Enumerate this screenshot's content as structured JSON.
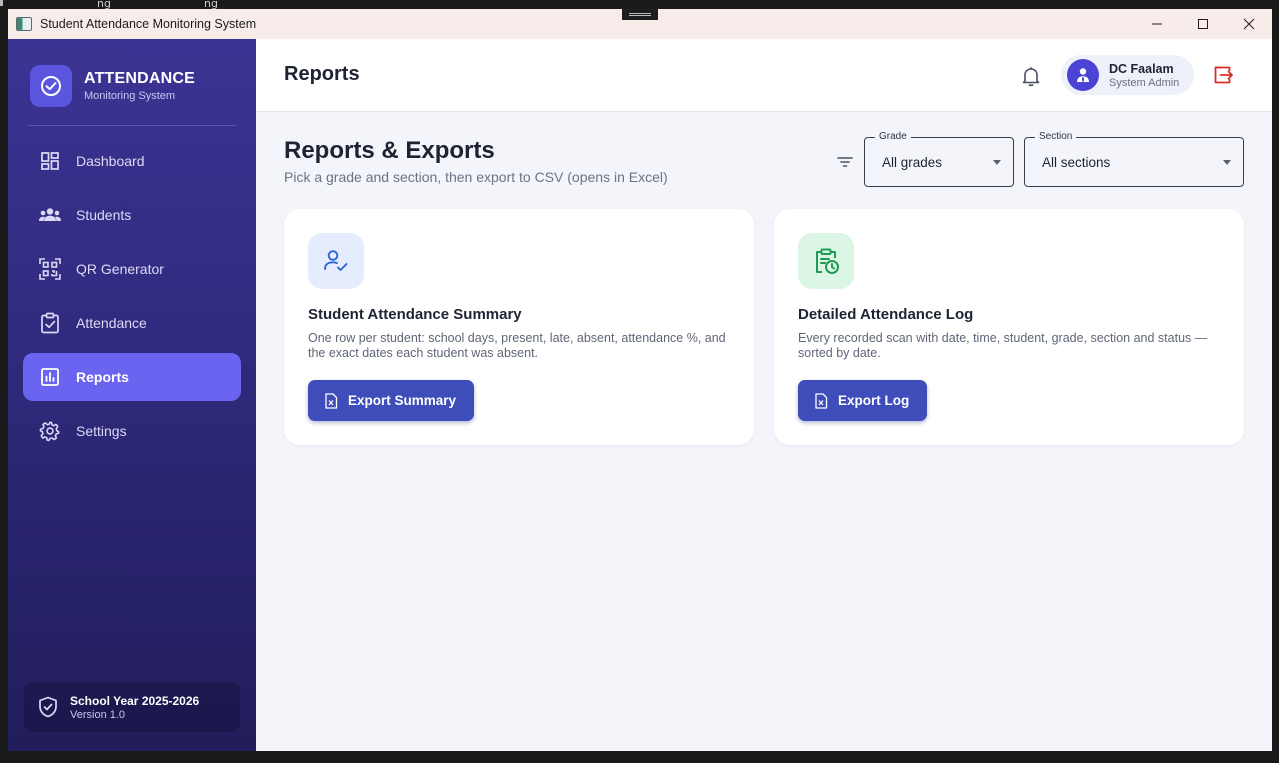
{
  "background": {
    "fragments": [
      "ng",
      "ng"
    ]
  },
  "window": {
    "title": "Student Attendance Monitoring System"
  },
  "brand": {
    "title": "ATTENDANCE",
    "subtitle": "Monitoring System"
  },
  "sidebar": {
    "items": [
      {
        "label": "Dashboard",
        "icon": "dashboard-icon",
        "active": false
      },
      {
        "label": "Students",
        "icon": "students-icon",
        "active": false
      },
      {
        "label": "QR Generator",
        "icon": "qr-code-icon",
        "active": false
      },
      {
        "label": "Attendance",
        "icon": "clipboard-check-icon",
        "active": false
      },
      {
        "label": "Reports",
        "icon": "bar-chart-icon",
        "active": true
      },
      {
        "label": "Settings",
        "icon": "gear-icon",
        "active": false
      }
    ],
    "footer": {
      "title": "School Year 2025-2026",
      "version": "Version 1.0"
    }
  },
  "header": {
    "page_title": "Reports",
    "user": {
      "name": "DC Faalam",
      "role": "System Admin"
    }
  },
  "content": {
    "heading": "Reports & Exports",
    "subheading": "Pick a grade and section, then export to CSV (opens in Excel)",
    "filters": {
      "grade": {
        "label": "Grade",
        "value": "All grades"
      },
      "section": {
        "label": "Section",
        "value": "All sections"
      }
    },
    "cards": [
      {
        "title": "Student Attendance Summary",
        "description": "One row per student: school days, present, late, absent, attendance %, and the exact dates each student was absent.",
        "button": "Export Summary",
        "accent": "#e4ecfd"
      },
      {
        "title": "Detailed Attendance Log",
        "description": "Every recorded scan with date, time, student, grade, section and status — sorted by date.",
        "button": "Export Log",
        "accent": "#dcf6e6"
      }
    ]
  },
  "colors": {
    "primary": "#3f4dbb",
    "sidebar_active": "#6a64f0",
    "logout": "#d93025"
  }
}
